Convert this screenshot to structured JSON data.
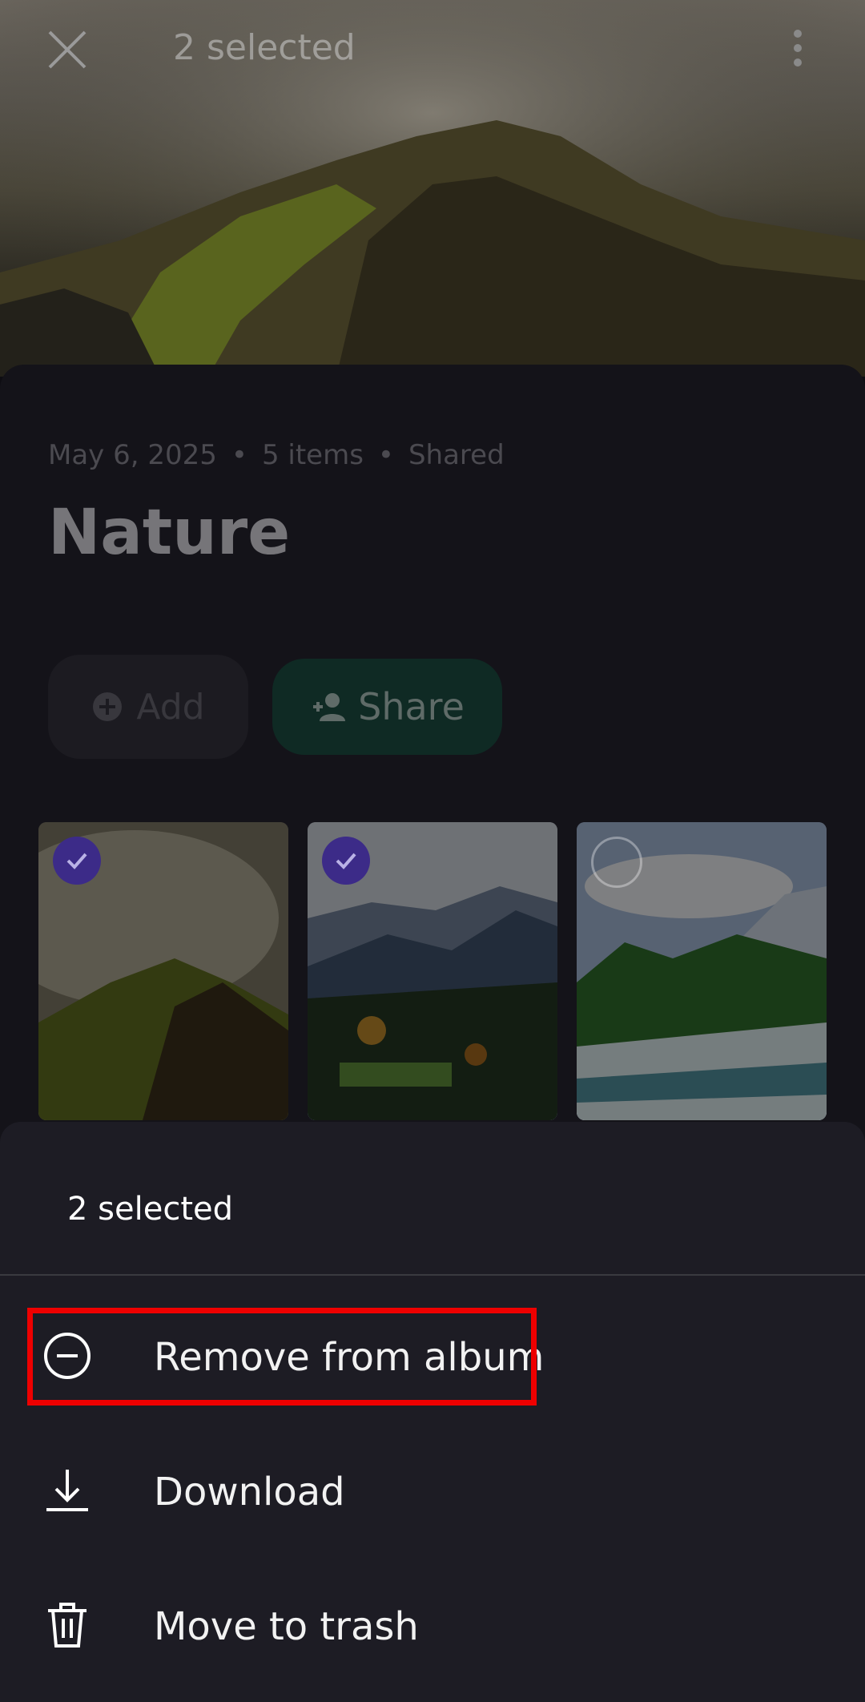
{
  "topbar": {
    "title": "2 selected",
    "close_icon": "close-icon",
    "more_icon": "more-vert-icon"
  },
  "album": {
    "date": "May 6, 2025",
    "items": "5 items",
    "status": "Shared",
    "title": "Nature"
  },
  "actions": {
    "add_label": "Add",
    "share_label": "Share"
  },
  "photos": [
    {
      "name": "foggy-hill",
      "selected": true
    },
    {
      "name": "mountain-valley",
      "selected": true
    },
    {
      "name": "river-rapids",
      "selected": false
    }
  ],
  "sheet": {
    "title": "2 selected",
    "items": [
      {
        "label": "Remove from album",
        "icon": "remove-circle-icon"
      },
      {
        "label": "Download",
        "icon": "download-icon"
      },
      {
        "label": "Move to trash",
        "icon": "trash-icon"
      }
    ]
  },
  "colors": {
    "accent_check": "#3c2b88",
    "sheet_bg": "#1d1c24",
    "highlight": "#ee0000"
  }
}
